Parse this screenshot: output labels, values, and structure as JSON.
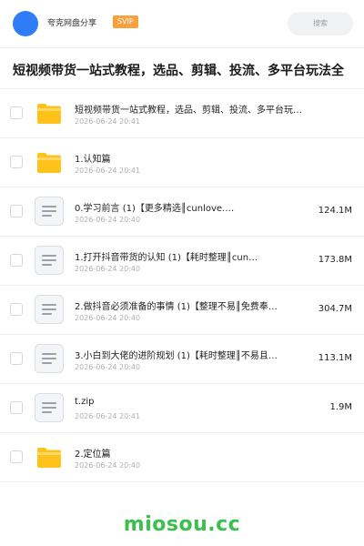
{
  "header": {
    "share_name": "夸克网盘分享",
    "badge": "SVIP",
    "search_placeholder": "搜索"
  },
  "title": "短视频带货一站式教程，选品、剪辑、投流、多平台玩法全",
  "files": [
    {
      "type": "folder",
      "name": "短视频带货一站式教程，选品、剪辑、投流、多平台玩法…",
      "date": "2026-06-24 20:41",
      "size": ""
    },
    {
      "type": "folder",
      "name": "1.认知篇",
      "date": "2026-06-24 20:41",
      "size": ""
    },
    {
      "type": "file",
      "name": "0.学习前言 (1)【更多精选║cunlove.…",
      "date": "2026-06-24 20:40",
      "size": "124.1M"
    },
    {
      "type": "file",
      "name": "1.打开抖音带货的认知 (1)【耗时整理║cun…",
      "date": "2026-06-24 20:40",
      "size": "173.8M"
    },
    {
      "type": "file",
      "name": "2.做抖音必须准备的事情 (1)【整理不易║免费奉…",
      "date": "2026-06-24 20:40",
      "size": "304.7M"
    },
    {
      "type": "file",
      "name": "3.小白到大佬的进阶规划 (1)【耗时整理║不易且…",
      "date": "2026-06-24 20:40",
      "size": "113.1M"
    },
    {
      "type": "file",
      "name": "t.zip",
      "date": "2026-06-24 20:41",
      "size": "1.9M"
    },
    {
      "type": "folder",
      "name": "2.定位篇",
      "date": "2026-06-24 20:40",
      "size": ""
    }
  ],
  "watermark": "miosou.cc",
  "colors": {
    "folder": "#ffc21a",
    "folder_tab": "#ffd766",
    "badge": "#f7a03c",
    "avatar": "#2f7df6",
    "watermark": "#3bbf4d"
  },
  "icons": {
    "folder": "folder-icon",
    "file": "document-icon"
  }
}
